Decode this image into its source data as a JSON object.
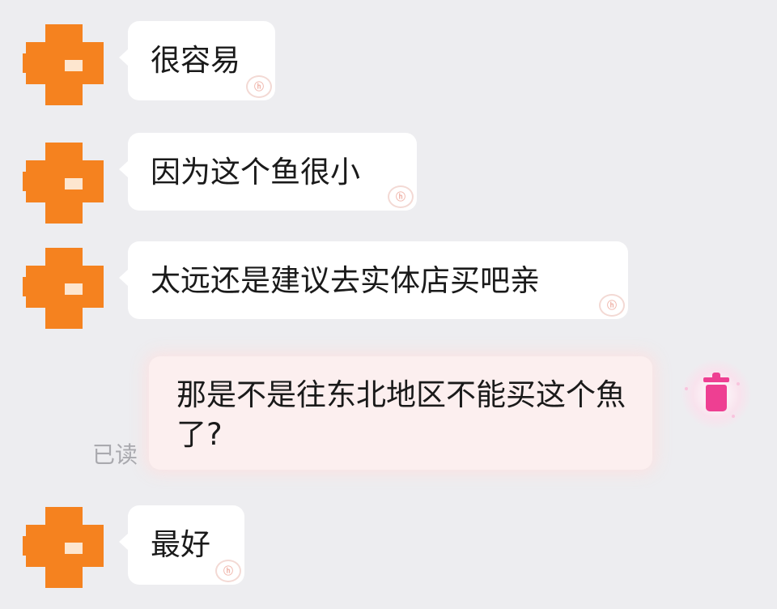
{
  "messages": [
    {
      "text": "很容易",
      "watermark": "ⓗ"
    },
    {
      "text": "因为这个鱼很小",
      "watermark": "ⓗ"
    },
    {
      "text": "太远还是建议去实体店买吧亲",
      "watermark": "ⓗ"
    },
    {
      "text": "最好",
      "watermark": "ⓗ"
    }
  ],
  "my_message": {
    "text": "那是不是往东北地区不能买这个魚了?",
    "read_status": "已读"
  },
  "icons": {
    "avatar": "avatar-icon",
    "delete": "trash-icon"
  },
  "colors": {
    "avatar": "#f5821f",
    "page_background": "#ededf0",
    "incoming_bubble": "#ffffff",
    "outgoing_bubble": "#fcefef",
    "delete_icon": "#ee3f92"
  }
}
